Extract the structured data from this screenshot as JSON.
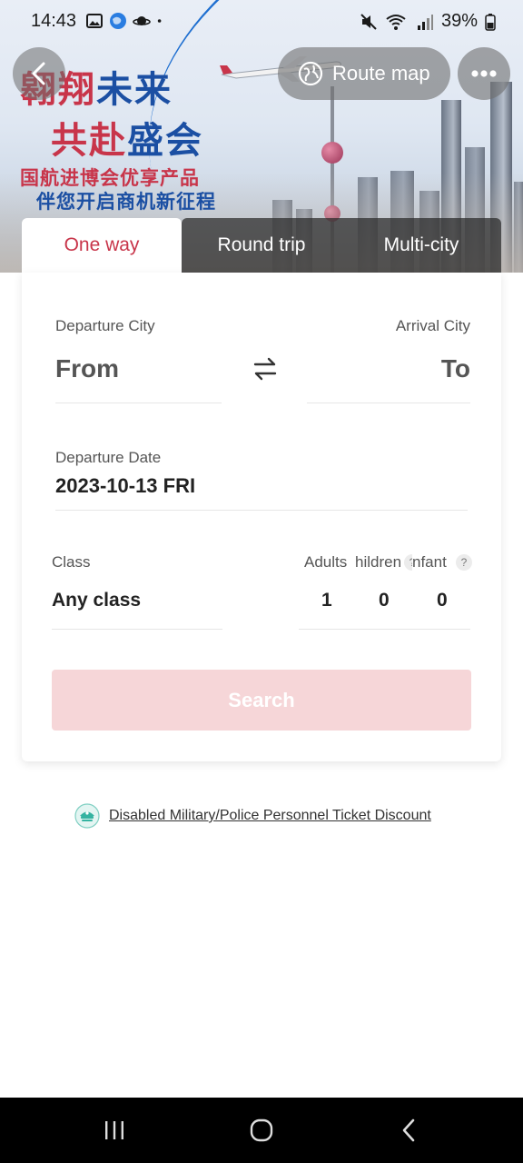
{
  "status_bar": {
    "time": "14:43",
    "battery": "39%",
    "left_icons": [
      "gallery-icon",
      "globe-app-icon",
      "saturn-app-icon",
      "dot-icon"
    ],
    "right_icons": [
      "mute-icon",
      "wifi-icon",
      "signal-icon",
      "battery-icon"
    ]
  },
  "banner": {
    "slogan_line1_red": "翱翔",
    "slogan_line1_blue": "未来",
    "slogan_line2_red": "共赴",
    "slogan_line2_blue": "盛会",
    "slogan_line3": "国航进博会优享产品",
    "slogan_line4": "伴您开启商机新征程"
  },
  "header": {
    "route_map_label": "Route map"
  },
  "tabs": [
    {
      "label": "One way",
      "active": true
    },
    {
      "label": "Round trip",
      "active": false
    },
    {
      "label": "Multi-city",
      "active": false
    }
  ],
  "form": {
    "departure_city_label": "Departure City",
    "arrival_city_label": "Arrival City",
    "from_placeholder": "From",
    "to_placeholder": "To",
    "departure_date_label": "Departure Date",
    "departure_date_value": "2023-10-13 FRI",
    "class_label": "Class",
    "class_value": "Any class",
    "adults_label": "Adults",
    "children_label": "hildren",
    "infant_label": "nfant",
    "help_glyph": "?",
    "adults_value": "1",
    "children_value": "0",
    "infant_value": "0",
    "search_label": "Search"
  },
  "discount": {
    "label": "Disabled Military/Police Personnel Ticket Discount"
  },
  "colors": {
    "accent_red": "#c8354a",
    "search_disabled": "#f6d6d8",
    "brand_blue": "#1b4fa3"
  }
}
